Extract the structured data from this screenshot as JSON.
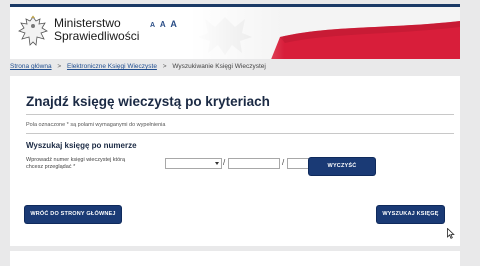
{
  "header": {
    "brand_line1": "Ministerstwo",
    "brand_line2": "Sprawiedliwości",
    "font_size_controls": [
      "A",
      "A",
      "A"
    ]
  },
  "breadcrumb": {
    "items": [
      "Strona główna",
      "Elektroniczne Księgi Wieczyste",
      "Wyszukiwanie Księgi Wieczystej"
    ],
    "separator": ">"
  },
  "main": {
    "title": "Znajdź księgę wieczystą po kryteriach",
    "required_note": "Pola oznaczone * są polami wymaganymi do wypełnienia",
    "section_title": "Wyszukaj księgę po numerze",
    "field_label": "Wprowadź numer księgi wieczystej którą chcesz przeglądać *",
    "separator": "/",
    "court_code_value": "",
    "number_value": "",
    "check_digit_value": "",
    "clear_button": "WYCZYŚĆ",
    "back_button": "WRÓĆ DO STRONY GŁÓWNEJ",
    "search_button": "WYSZUKAJ KSIĘGĘ"
  },
  "colors": {
    "primary_button": "#1a3a75",
    "link": "#1f4d8f",
    "flag_red": "#d81e3a"
  }
}
